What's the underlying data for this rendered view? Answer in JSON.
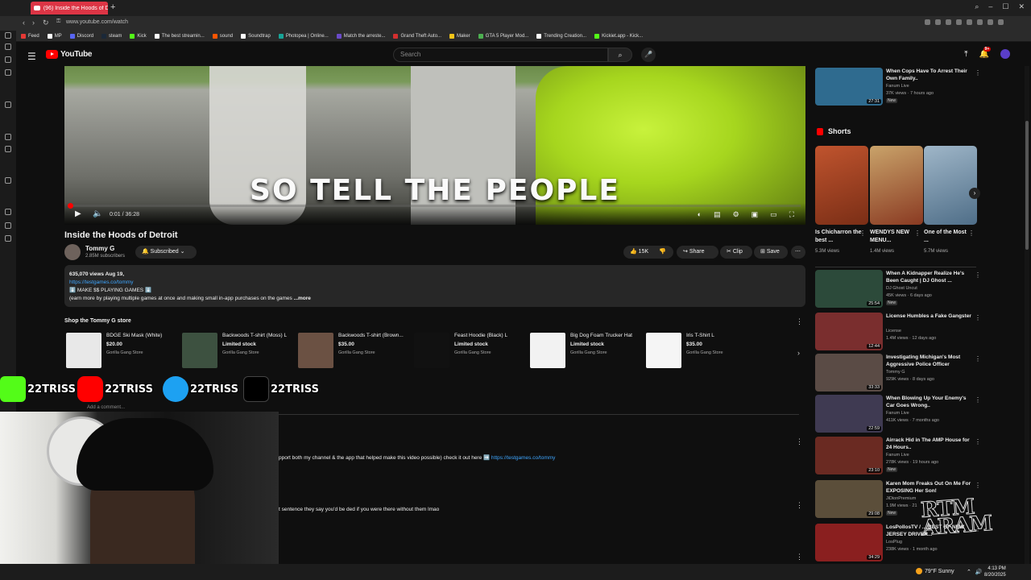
{
  "browser": {
    "tab_title": "(96) Inside the Hoods of D",
    "url": "www.youtube.com/watch",
    "new_tab": "+",
    "bookmarks": [
      {
        "label": "Feed",
        "color": "#e53935"
      },
      {
        "label": "MP",
        "color": "#ffffff"
      },
      {
        "label": "Discord",
        "color": "#5865f2"
      },
      {
        "label": "steam",
        "color": "#1b2838"
      },
      {
        "label": "Kick",
        "color": "#53fc18"
      },
      {
        "label": "The best streamin...",
        "color": "#ffffff"
      },
      {
        "label": "sound",
        "color": "#ff5500"
      },
      {
        "label": "Soundtrap",
        "color": "#ffffff"
      },
      {
        "label": "Photopea | Online...",
        "color": "#18a497"
      },
      {
        "label": "Match the arreste...",
        "color": "#6a4ac8"
      },
      {
        "label": "Grand Theft Auto...",
        "color": "#d32f2f"
      },
      {
        "label": "Maker",
        "color": "#f5c518"
      },
      {
        "label": "GTA 5 Player Mod...",
        "color": "#4caf50"
      },
      {
        "label": "Trending Creation...",
        "color": "#ffffff"
      },
      {
        "label": "Kickiet.app - Kick...",
        "color": "#53fc18"
      }
    ]
  },
  "youtube": {
    "logo_text": "YouTube",
    "search_placeholder": "Search",
    "notification_count": "9+"
  },
  "player": {
    "caption": "SO TELL THE PEOPLE",
    "time": "0:01 / 36:28",
    "progress_fraction": 0.0005
  },
  "video": {
    "title": "Inside the Hoods of Detroit",
    "channel": "Tommy G",
    "subscribers": "2.85M subscribers",
    "subscribed_label": "Subscribed",
    "likes": "15K",
    "share": "Share",
    "clip": "Clip",
    "save": "Save"
  },
  "description": {
    "meta": "635,070 views  Aug 19,",
    "link": "https://testgames.co/tommy",
    "line2": "⬇️ MAKE $$ PLAYING GAMES ⬇️",
    "line3": "(earn more by playing multiple games at once and making small in-app purchases on the games",
    "more": "...more"
  },
  "store": {
    "title": "Shop the Tommy G store",
    "products": [
      {
        "name": "BDGE Ski Mask (White)",
        "price": "$20.00",
        "stock": "",
        "seller": "Gorilla Gang Store"
      },
      {
        "name": "Backwoods T-shirt (Moss) L",
        "price": "Limited stock",
        "stock": "",
        "seller": "Gorilla Gang Store"
      },
      {
        "name": "Backwoods T-shirt (Brown...",
        "price": "$35.00",
        "stock": "",
        "seller": "Gorilla Gang Store"
      },
      {
        "name": "Feast Hoodie (Black) L",
        "price": "Limited stock",
        "stock": "",
        "seller": "Gorilla Gang Store"
      },
      {
        "name": "Big Dog Foam Trucker Hat",
        "price": "Limited stock",
        "stock": "",
        "seller": "Gorilla Gang Store"
      },
      {
        "name": "Iris T-Shirt L",
        "price": "$35.00",
        "stock": "",
        "seller": "Gorilla Gang Store"
      }
    ]
  },
  "social": {
    "handle": "22TRISS"
  },
  "comments": {
    "add_comment": "Add a comment...",
    "c1_text": "pport both my channel & the app that helped make this video possible) check it out here ➡️",
    "c1_link": "https://testgames.co/tommy",
    "c2_text": "t sentence they say you'd be ded if you were there without them lmao"
  },
  "shorts": {
    "title": "Shorts",
    "items": [
      {
        "title": "Is Chicharron the best ...",
        "views": "5.3M views"
      },
      {
        "title": "WENDYS NEW MENU...",
        "views": "1.4M views"
      },
      {
        "title": "One of the Most ...",
        "views": "5.7M views"
      }
    ]
  },
  "related": [
    {
      "title": "When Cops Have To Arrest Their Own Family..",
      "channel": "Fanum Live",
      "meta": "37K views · 7 hours ago",
      "duration": "27:31",
      "new": "New"
    },
    {
      "title": "When A Kidnapper Realize He's Been Caught | DJ Ghost ...",
      "channel": "DJ Ghost Uncut",
      "meta": "45K views · 6 days ago",
      "duration": "25:54",
      "new": "New"
    },
    {
      "title": "License Humbles a Fake Gangster",
      "channel": "License",
      "meta": "1.4M views · 12 days ago",
      "duration": "12:44",
      "new": ""
    },
    {
      "title": "Investigating Michigan's Most Aggressive Police Officer",
      "channel": "Tommy G",
      "meta": "929K views · 8 days ago",
      "duration": "33:33",
      "new": ""
    },
    {
      "title": "When Blowing Up Your Enemy's Car Goes Wrong..",
      "channel": "Fanum Live",
      "meta": "411K views · 7 months ago",
      "duration": "22:59",
      "new": ""
    },
    {
      "title": "Airrack Hid in The AMP House for 24 Hours..",
      "channel": "Fanum Live",
      "meta": "278K views · 19 hours ago",
      "duration": "23:10",
      "new": "New"
    },
    {
      "title": "Karen Mom Freaks Out On Me For EXPOSING Her Son!",
      "channel": "JiDionPremium",
      "meta": "1.9M views · 21",
      "duration": "29:08",
      "new": "New"
    },
    {
      "title": "LosPollosTV / ... BEST OF NEW JERSEY DRIVER...",
      "channel": "LosPlug",
      "meta": "238K views · 1 month ago",
      "duration": "34:29",
      "new": ""
    }
  ],
  "watermark": "RTM ARAM",
  "taskbar": {
    "weather": "79°F  Sunny",
    "time": "4:13 PM",
    "date": "8/20/2025"
  }
}
